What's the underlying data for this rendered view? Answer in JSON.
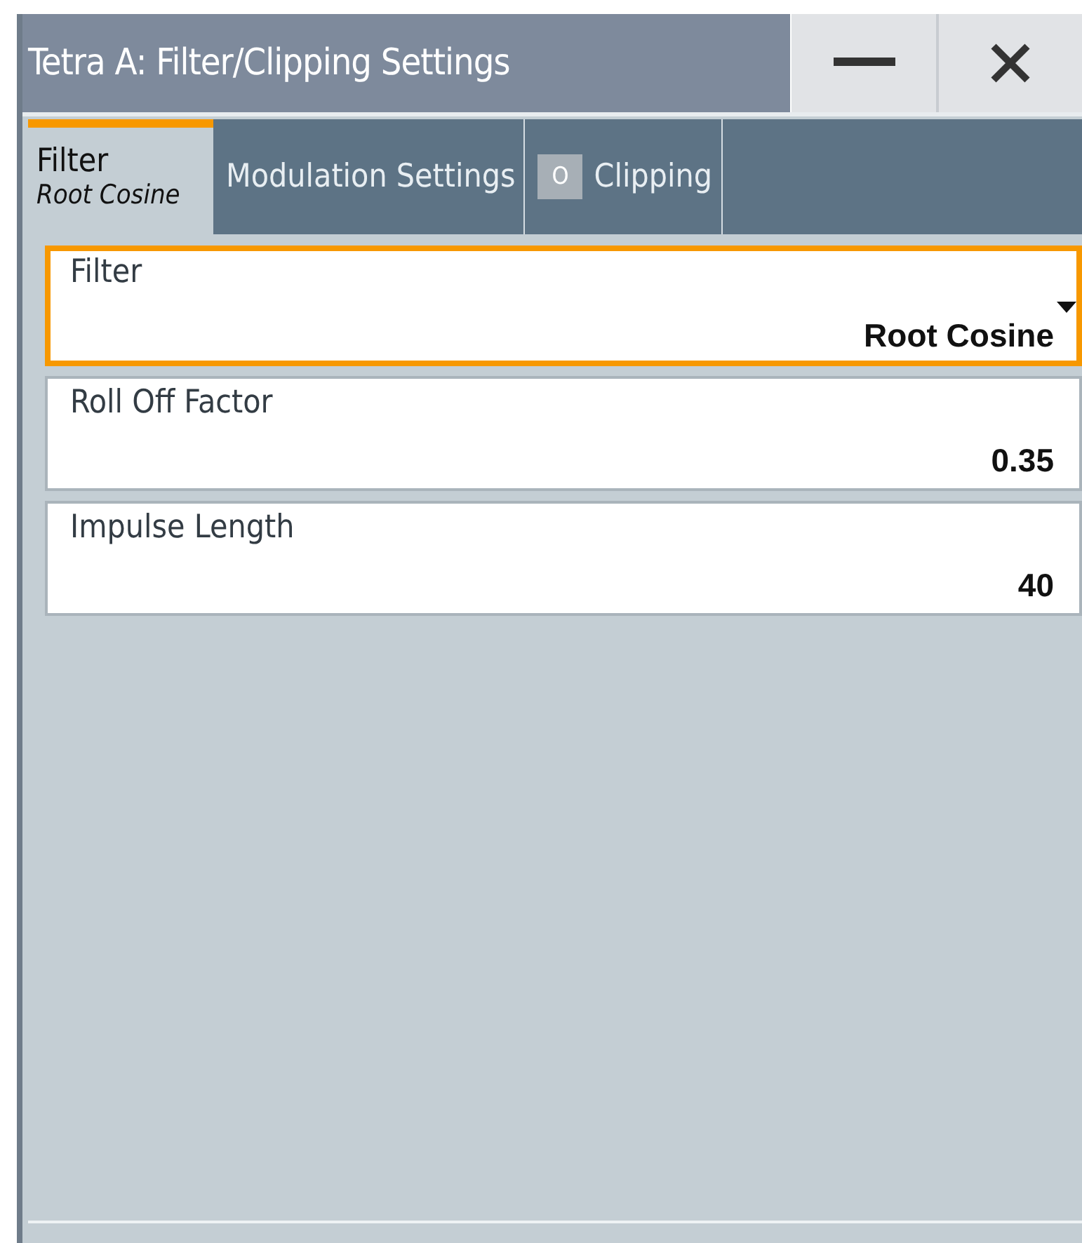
{
  "window": {
    "title": "Tetra A: Filter/Clipping Settings",
    "buttons": [
      {
        "kind": "minimize"
      },
      {
        "kind": "close"
      }
    ]
  },
  "tabs": [
    {
      "label": "Filter",
      "sublabel": "Root Cosine",
      "selected": true
    },
    {
      "label": "Modulation Settings",
      "selected": false
    },
    {
      "label": "Clipping",
      "selected": false,
      "toggle": {
        "text": "O",
        "on": false
      }
    }
  ],
  "fields": [
    {
      "kind": "dropdown",
      "label": "Filter",
      "value": "Root Cosine",
      "focused": true
    },
    {
      "kind": "number",
      "label": "Roll Off Factor",
      "value": "0.35",
      "focused": false
    },
    {
      "kind": "number",
      "label": "Impulse Length",
      "value": "40",
      "focused": false
    }
  ]
}
